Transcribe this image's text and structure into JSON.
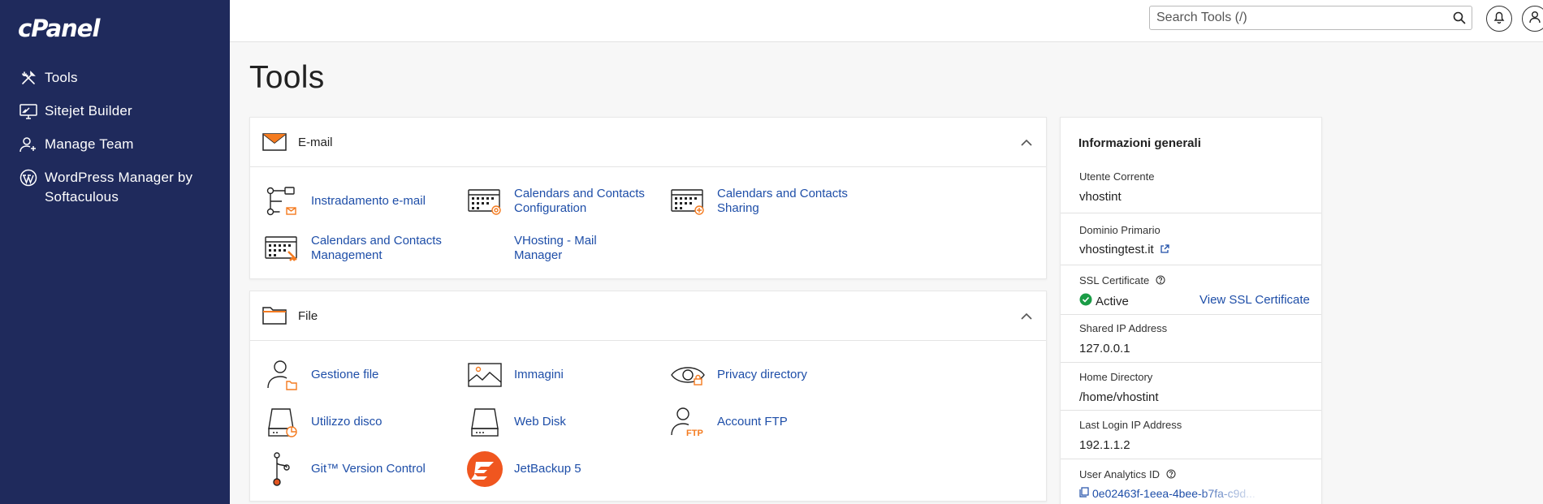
{
  "app": {
    "logo_text": "cPanel"
  },
  "sidebar": {
    "items": [
      {
        "label": "Tools",
        "icon": "tools-icon"
      },
      {
        "label": "Sitejet Builder",
        "icon": "sitejet-icon"
      },
      {
        "label": "Manage Team",
        "icon": "manage-team-icon"
      },
      {
        "label": "WordPress Manager by Softaculous",
        "icon": "wordpress-icon"
      }
    ]
  },
  "topbar": {
    "search_placeholder": "Search Tools (/)",
    "search_value": "",
    "icons": [
      "search-icon",
      "bell-icon",
      "user-icon"
    ]
  },
  "main": {
    "title": "Tools",
    "sections": [
      {
        "title": "E-mail",
        "icon": "envelope-icon",
        "tools": [
          {
            "label": "Instradamento e-mail",
            "icon": "email-routing-icon"
          },
          {
            "label": "Calendars and Contacts Configuration",
            "icon": "calendar-config-icon"
          },
          {
            "label": "Calendars and Contacts Sharing",
            "icon": "calendar-sharing-icon"
          },
          {
            "label": "Calendars and Contacts Management",
            "icon": "calendar-management-icon"
          },
          {
            "label": "VHosting - Mail Manager",
            "icon": ""
          }
        ]
      },
      {
        "title": "File",
        "icon": "folder-icon",
        "tools": [
          {
            "label": "Gestione file",
            "icon": "file-manager-icon"
          },
          {
            "label": "Immagini",
            "icon": "images-icon"
          },
          {
            "label": "Privacy directory",
            "icon": "eye-icon"
          },
          {
            "label": "Utilizzo disco",
            "icon": "disk-usage-icon"
          },
          {
            "label": "Web Disk",
            "icon": "web-disk-icon"
          },
          {
            "label": "Account FTP",
            "icon": "ftp-icon"
          },
          {
            "label": "Git™ Version Control",
            "icon": "git-icon"
          },
          {
            "label": "JetBackup 5",
            "icon": "jetbackup-icon"
          }
        ]
      }
    ]
  },
  "info": {
    "title": "Informazioni generali",
    "current_user_label": "Utente Corrente",
    "current_user_value": "vhostint",
    "primary_domain_label": "Dominio Primario",
    "primary_domain_value": "vhostingtest.it",
    "ssl_label": "SSL Certificate",
    "ssl_status": "Active",
    "ssl_link": "View SSL Certificate",
    "shared_ip_label": "Shared IP Address",
    "shared_ip_value": "127.0.0.1",
    "home_dir_label": "Home Directory",
    "home_dir_value": "/home/vhostint",
    "last_login_label": "Last Login IP Address",
    "last_login_value": "192.1.1.2",
    "analytics_label": "User Analytics ID",
    "analytics_value": "0e02463f-1eea-4bee-b7fa-c9d..."
  },
  "colors": {
    "sidebar_bg": "#1f2a5c",
    "link": "#1e4ea8",
    "accent_orange": "#f47b20",
    "ssl_active": "#1a9c46"
  }
}
